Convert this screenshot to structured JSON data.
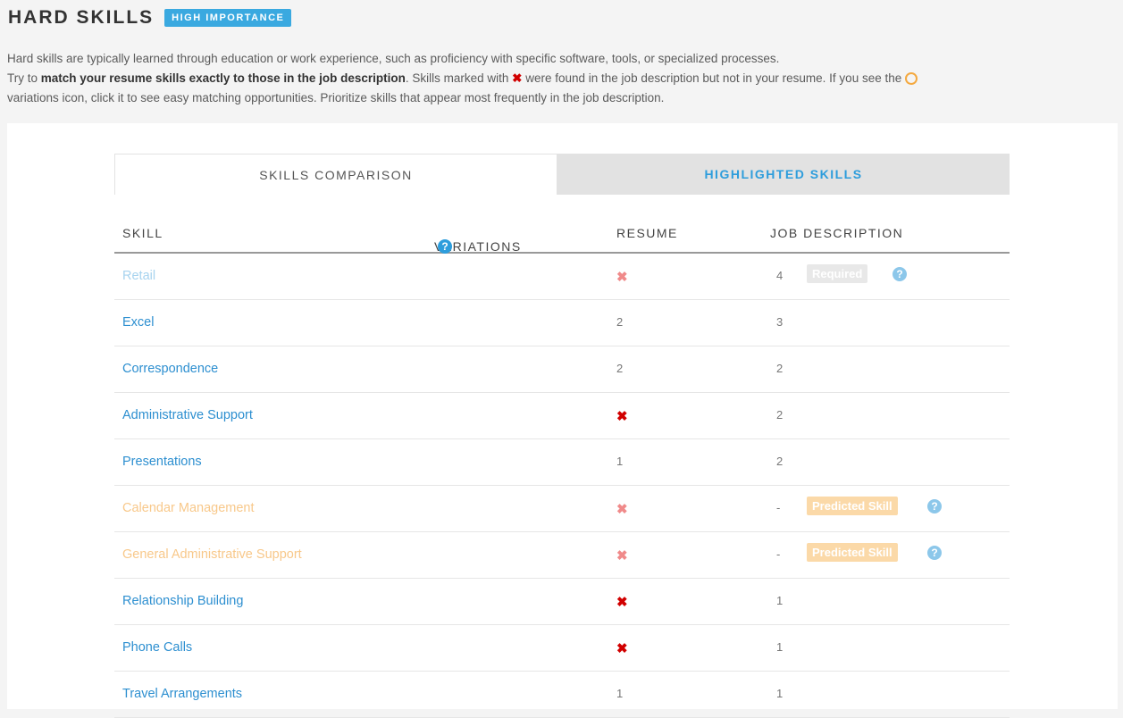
{
  "header": {
    "title": "HARD SKILLS",
    "badge": "HIGH IMPORTANCE"
  },
  "intro": {
    "line1": "Hard skills are typically learned through education or work experience, such as proficiency with specific software, tools, or specialized processes.",
    "line2_prefix": "Try to ",
    "line2_bold": "match your resume skills exactly to those in the job description",
    "line2_middle": ". Skills marked with ",
    "line2_after_x": " were found in the job description but not in your resume. If you see the ",
    "line3": "variations icon, click it to see easy matching opportunities. Prioritize skills that appear most frequently in the job description."
  },
  "tabs": {
    "comparison": "SKILLS COMPARISON",
    "highlighted": "HIGHLIGHTED SKILLS"
  },
  "table": {
    "col_skill": "SKILL",
    "col_variations": "VARIATIONS",
    "col_resume": "RESUME",
    "col_job": "JOB DESCRIPTION",
    "rows": [
      {
        "skill": "Retail",
        "resume": "✖",
        "job": "4",
        "tag": "Required"
      },
      {
        "skill": "Excel",
        "resume": "2",
        "job": "3"
      },
      {
        "skill": "Correspondence",
        "resume": "2",
        "job": "2"
      },
      {
        "skill": "Administrative Support",
        "resume": "✖",
        "job": "2"
      },
      {
        "skill": "Presentations",
        "resume": "1",
        "job": "2"
      },
      {
        "skill": "Calendar Management",
        "resume": "✖",
        "job": "-",
        "tag": "Predicted Skill"
      },
      {
        "skill": "General Administrative Support",
        "resume": "✖",
        "job": "-",
        "tag": "Predicted Skill"
      },
      {
        "skill": "Relationship Building",
        "resume": "✖",
        "job": "1"
      },
      {
        "skill": "Phone Calls",
        "resume": "✖",
        "job": "1"
      },
      {
        "skill": "Travel Arrangements",
        "resume": "1",
        "job": "1"
      }
    ]
  },
  "colors": {
    "accent": "#2d9ddc",
    "missing": "#d10000",
    "predicted": "#f8c88a"
  },
  "icons": {
    "help": "question-circle-icon",
    "missing": "x-icon",
    "variations": "ring-icon"
  }
}
